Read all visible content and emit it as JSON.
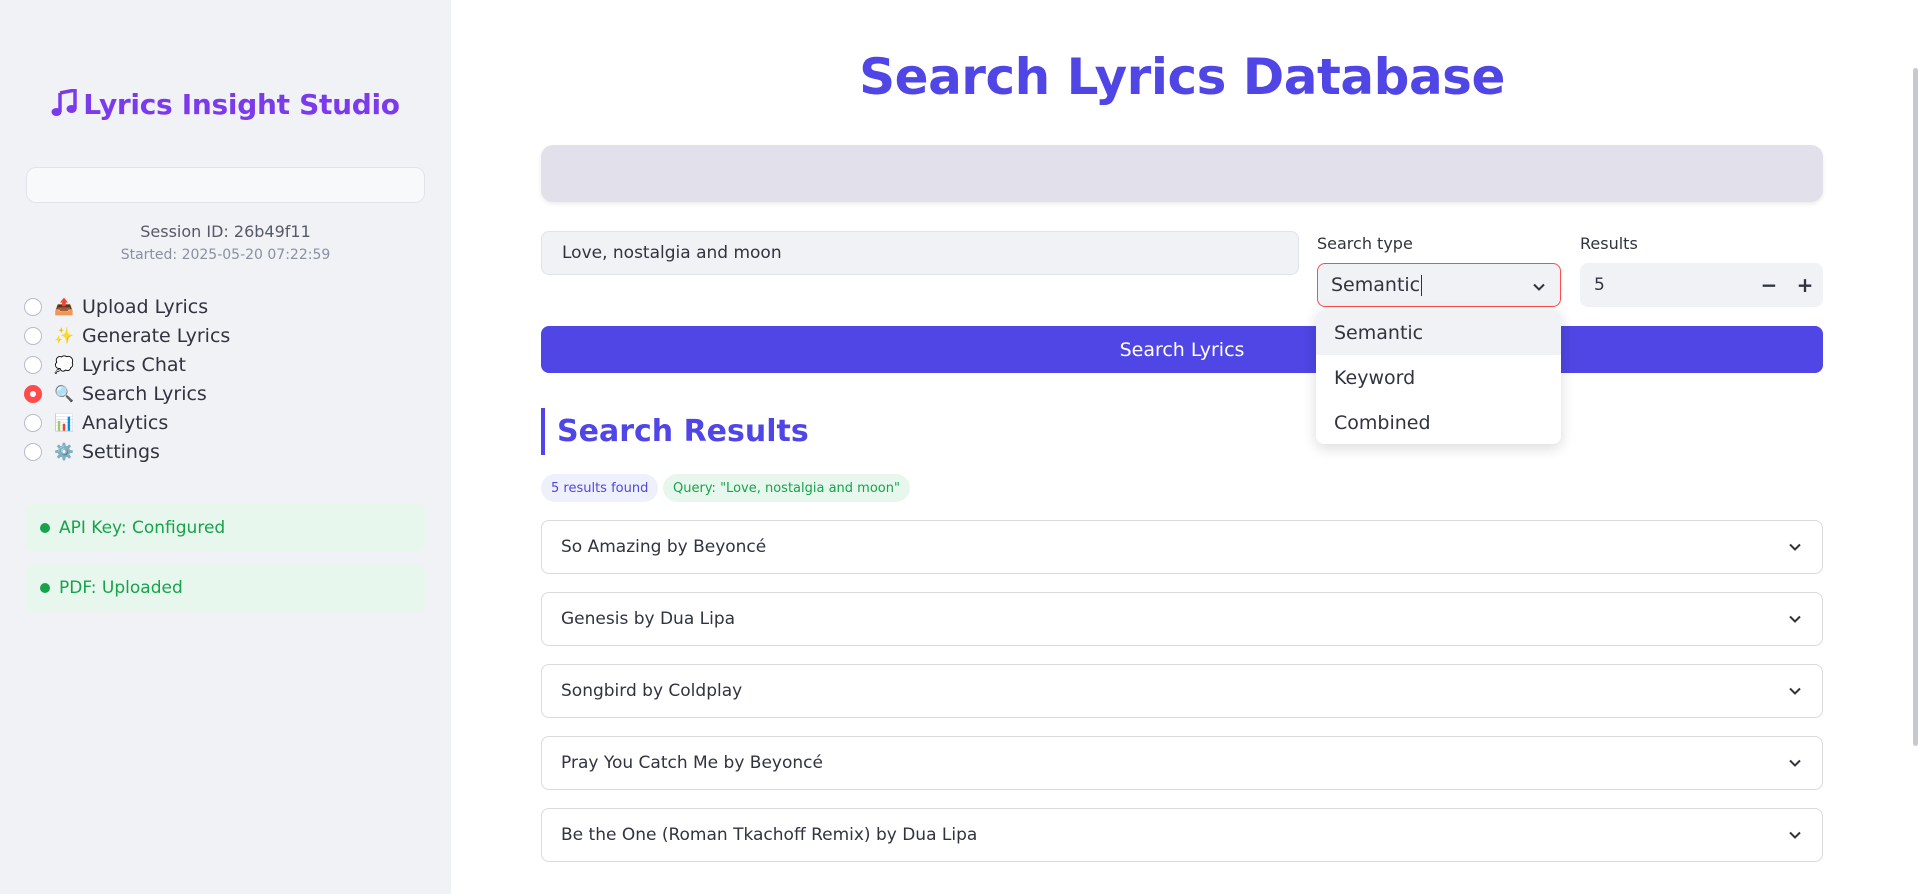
{
  "sidebar": {
    "brand": "Lyrics Insight Studio",
    "brand_icon": "music-note-icon",
    "session_id": "Session ID: 26b49f11",
    "started": "Started: 2025-05-20 07:22:59",
    "nav": [
      {
        "emoji": "📤",
        "label": "Upload Lyrics",
        "selected": false
      },
      {
        "emoji": "✨",
        "label": "Generate Lyrics",
        "selected": false
      },
      {
        "emoji": "💭",
        "label": "Lyrics Chat",
        "selected": false
      },
      {
        "emoji": "🔍",
        "label": "Search Lyrics",
        "selected": true
      },
      {
        "emoji": "📊",
        "label": "Analytics",
        "selected": false
      },
      {
        "emoji": "⚙️",
        "label": "Settings",
        "selected": false
      }
    ],
    "status": [
      {
        "label": "API Key: Configured"
      },
      {
        "label": "PDF: Uploaded"
      }
    ]
  },
  "main": {
    "title": "Search Lyrics Database",
    "query_value": "Love, nostalgia and moon",
    "search_type_label": "Search type",
    "search_type_value": "Semantic",
    "search_type_options": [
      "Semantic",
      "Keyword",
      "Combined"
    ],
    "results_label": "Results",
    "results_value": "5",
    "minus": "−",
    "plus": "+",
    "search_button": "Search Lyrics",
    "results_heading": "Search Results",
    "badge_count": "5 results found",
    "badge_query": "Query: \"Love, nostalgia and moon\"",
    "results": [
      "So Amazing by Beyoncé",
      "Genesis by Dua Lipa",
      "Songbird by Coldplay",
      "Pray You Catch Me by Beyoncé",
      "Be the One (Roman Tkachoff Remix) by Dua Lipa"
    ]
  },
  "colors": {
    "accent": "#4f46e5",
    "brand": "#7c3aed",
    "success": "#16a34a",
    "radio_selected": "#ff4b4b"
  }
}
